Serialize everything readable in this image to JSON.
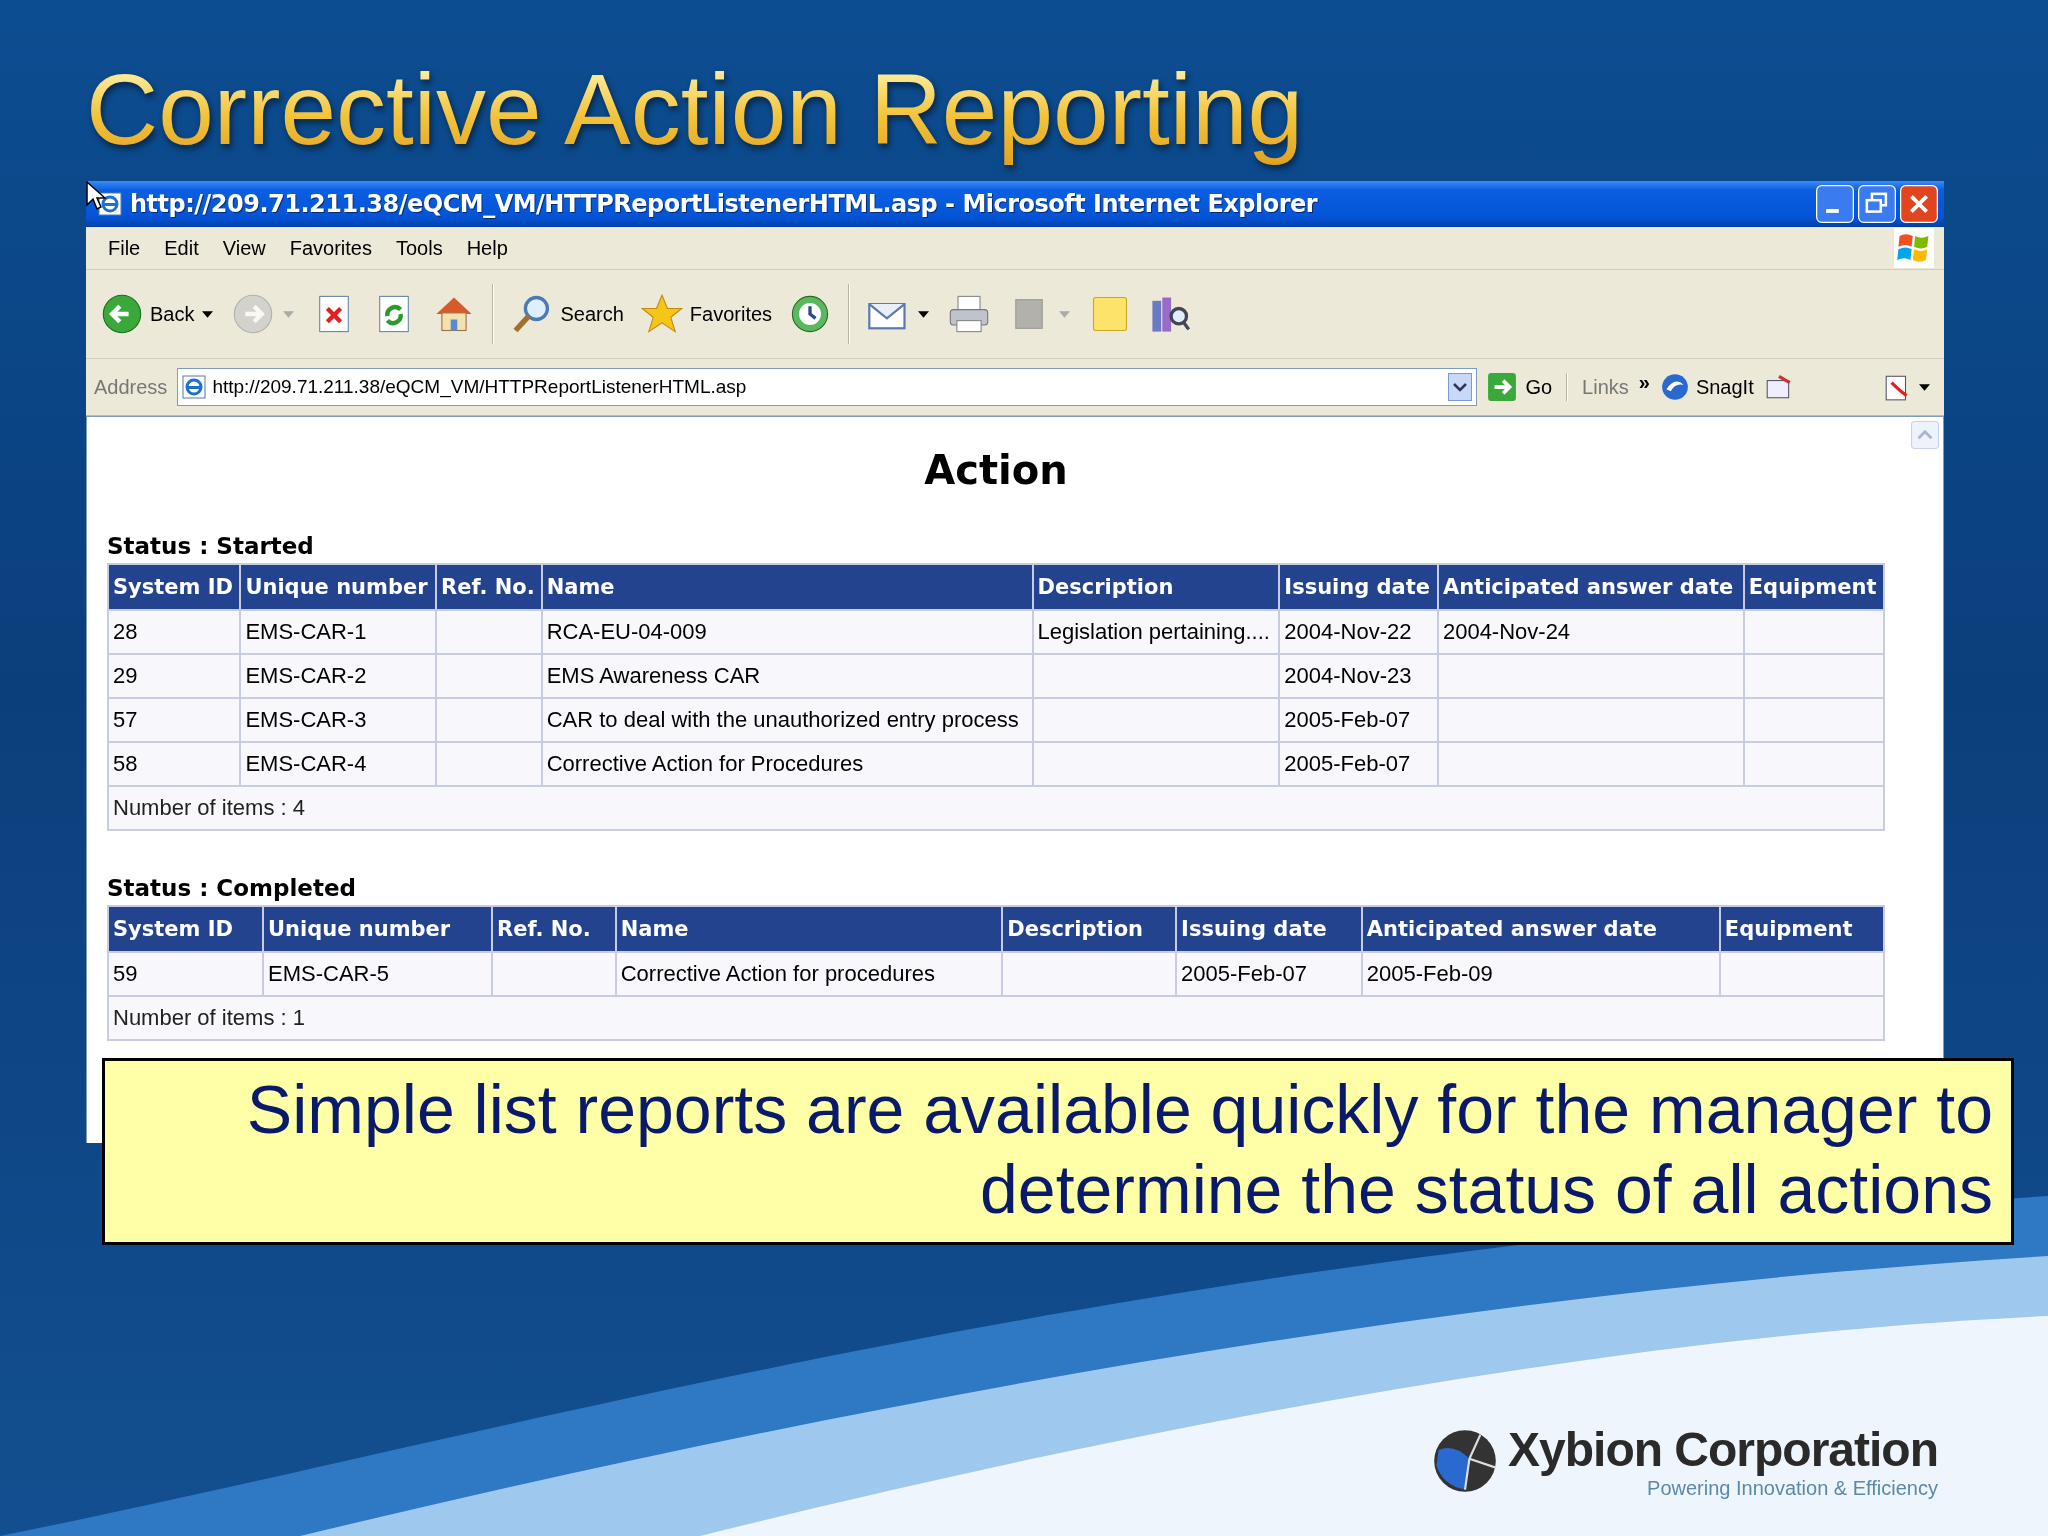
{
  "slide": {
    "title": "Corrective Action Reporting",
    "callout": "Simple list reports are available quickly for the manager to determine the status of all actions",
    "logo": {
      "name": "Xybion Corporation",
      "tagline": "Powering Innovation & Efficiency"
    }
  },
  "browser": {
    "title": "http://209.71.211.38/eQCM_VM/HTTPReportListenerHTML.asp - Microsoft Internet Explorer",
    "menu": [
      "File",
      "Edit",
      "View",
      "Favorites",
      "Tools",
      "Help"
    ],
    "toolbar": [
      {
        "kind": "back",
        "label": "Back",
        "dropdown": true,
        "disabled": false
      },
      {
        "kind": "forward",
        "dropdown": true,
        "disabled": true
      },
      {
        "kind": "stop",
        "disabled": false
      },
      {
        "kind": "refresh",
        "disabled": false
      },
      {
        "kind": "home",
        "disabled": false
      },
      {
        "kind": "search",
        "label": "Search",
        "disabled": false
      },
      {
        "kind": "favorites",
        "label": "Favorites",
        "disabled": false
      },
      {
        "kind": "history",
        "disabled": false
      },
      {
        "kind": "mail",
        "dropdown": true,
        "disabled": false
      },
      {
        "kind": "print",
        "disabled": false
      },
      {
        "kind": "edit",
        "dropdown": true,
        "disabled": true
      },
      {
        "kind": "note",
        "disabled": false
      },
      {
        "kind": "research",
        "disabled": false
      }
    ],
    "address": {
      "label": "Address",
      "value": "http://209.71.211.38/eQCM_VM/HTTPReportListenerHTML.asp",
      "go": "Go"
    },
    "links": {
      "label": "Links",
      "more": "»",
      "snagit": "SnagIt"
    }
  },
  "page": {
    "heading": "Action",
    "sections": [
      {
        "status": "Status : Started",
        "columns": [
          "System ID",
          "Unique number",
          "Ref. No.",
          "Name",
          "Description",
          "Issuing date",
          "Anticipated answer date",
          "Equipment"
        ],
        "rows": [
          [
            "28",
            "EMS-CAR-1",
            null,
            "RCA-EU-04-009",
            "Legislation pertaining....",
            "2004-Nov-22",
            "2004-Nov-24",
            null
          ],
          [
            "29",
            "EMS-CAR-2",
            null,
            "EMS Awareness CAR",
            null,
            "2004-Nov-23",
            null,
            null
          ],
          [
            "57",
            "EMS-CAR-3",
            null,
            "CAR to deal with the unauthorized entry process",
            null,
            "2005-Feb-07",
            null,
            null
          ],
          [
            "58",
            "EMS-CAR-4",
            null,
            "Corrective Action for Procedures",
            null,
            "2005-Feb-07",
            null,
            null
          ]
        ],
        "footer": "Number of items : 4"
      },
      {
        "status": "Status : Completed",
        "columns": [
          "System ID",
          "Unique number",
          "Ref. No.",
          "Name",
          "Description",
          "Issuing date",
          "Anticipated answer date",
          "Equipment"
        ],
        "rows": [
          [
            "59",
            "EMS-CAR-5",
            null,
            "Corrective Action for procedures",
            null,
            "2005-Feb-07",
            "2005-Feb-09",
            null
          ]
        ],
        "footer": "Number of items : 1"
      }
    ]
  }
}
